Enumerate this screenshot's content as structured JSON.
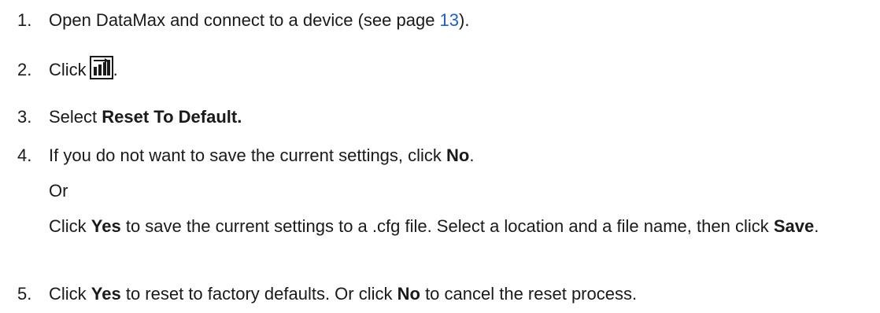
{
  "steps": [
    {
      "number": "1.",
      "text_before": "Open DataMax and connect to a device (see page ",
      "link": "13",
      "text_after": ")."
    },
    {
      "number": "2.",
      "text_before": "Click",
      "icon": "bar-chart-icon",
      "text_after": "."
    },
    {
      "number": "3.",
      "text_before": "Select ",
      "bold": "Reset To Default."
    },
    {
      "number": "4.",
      "text_before": "If you do not want to save the current settings, click ",
      "bold": "No",
      "text_after": ".",
      "or": "Or",
      "alt_before": "Click ",
      "alt_bold": "Yes",
      "alt_mid": " to save the current settings to a .cfg file. Select a location and a file name, then click ",
      "alt_bold2": "Save",
      "alt_after": "."
    },
    {
      "number": "5.",
      "text_before": "Click ",
      "bold": "Yes",
      "text_mid": " to reset to factory defaults. Or click ",
      "bold2": "No",
      "text_after": " to cancel the reset process."
    }
  ],
  "colors": {
    "link": "#1f5fc8",
    "text": "#1a1a1a",
    "icon_frame": "#1a1a1a"
  }
}
